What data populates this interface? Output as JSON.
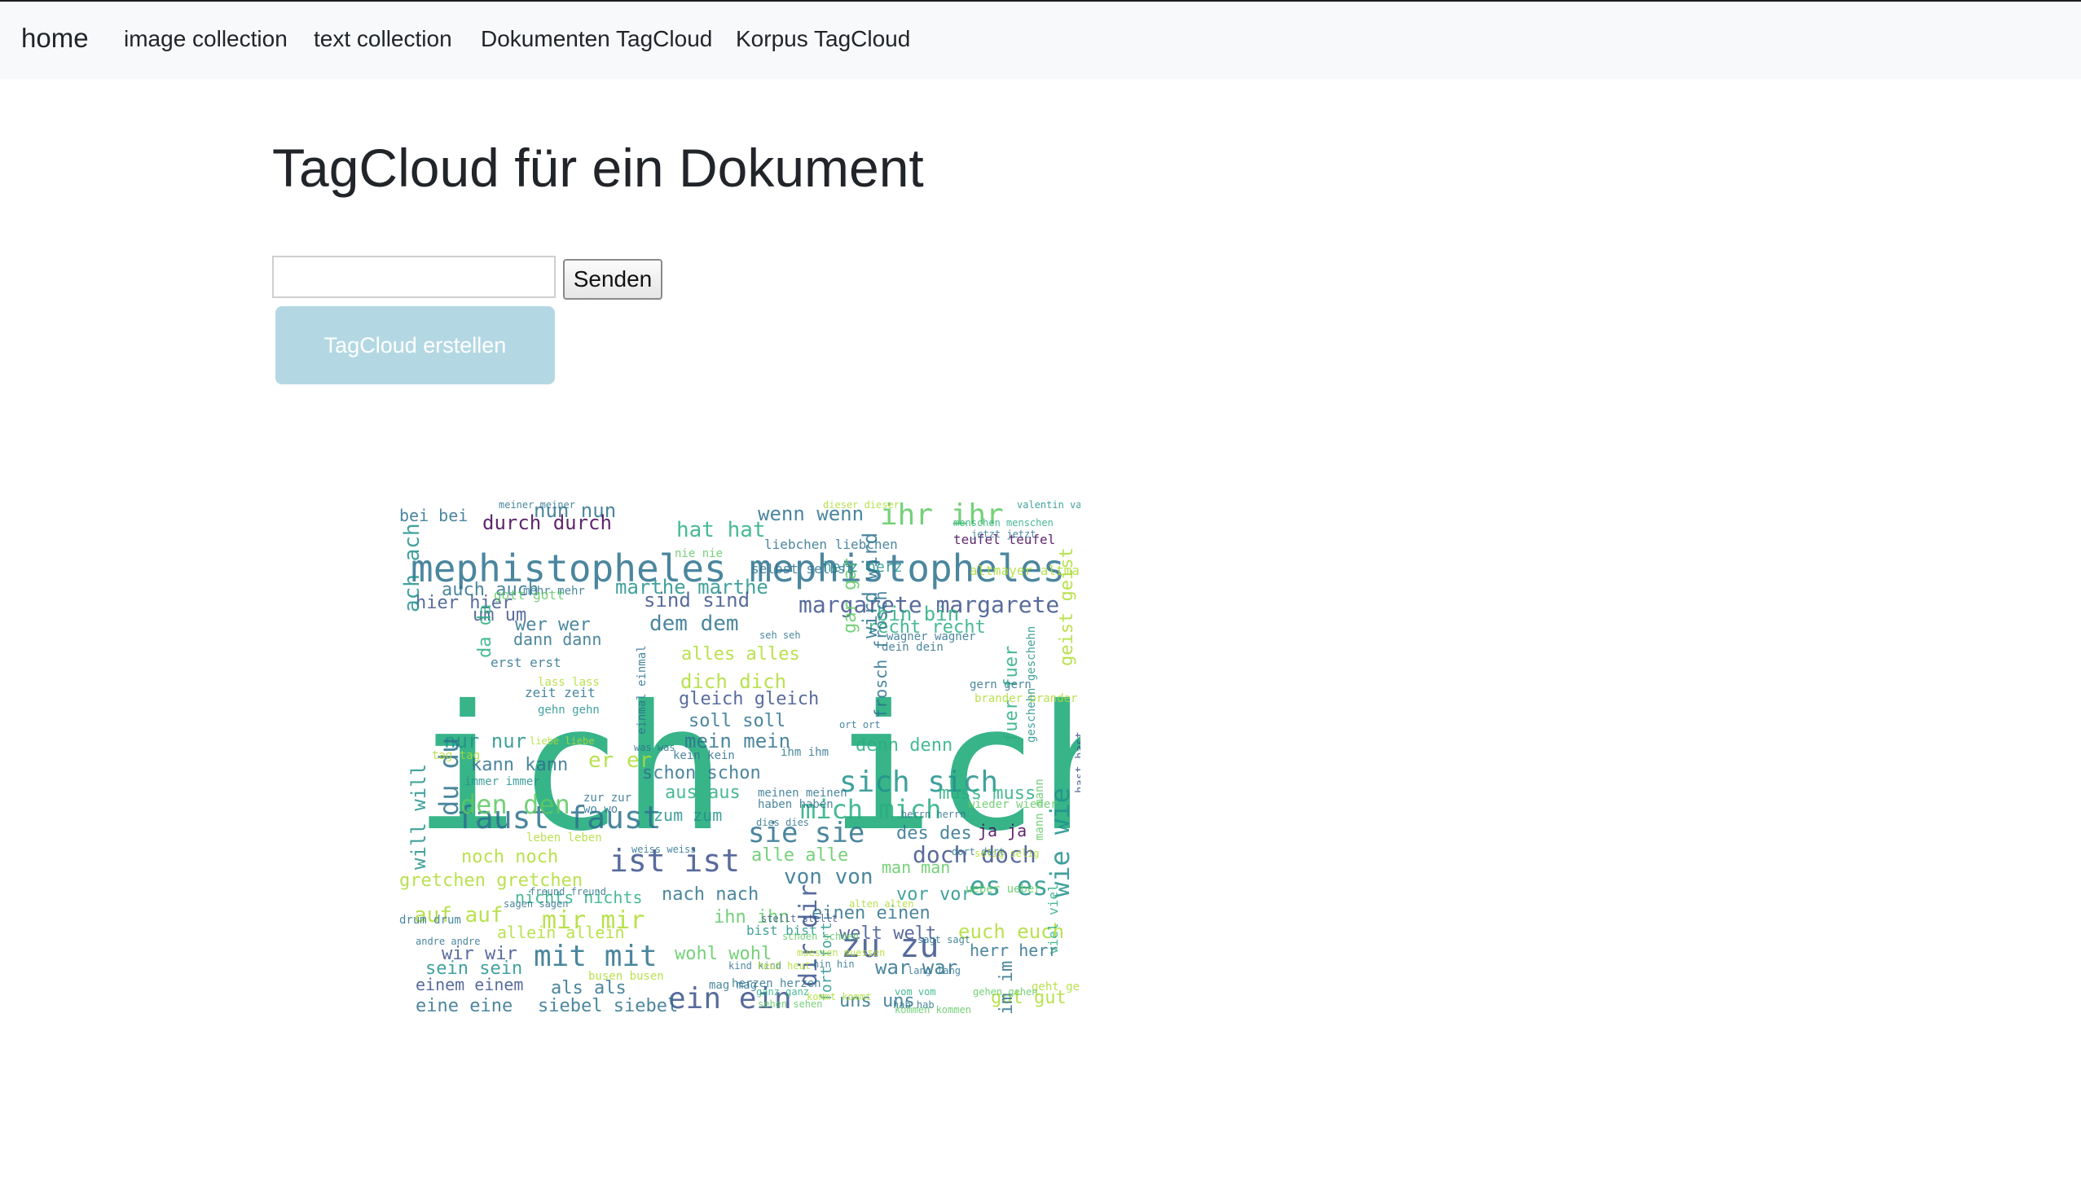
{
  "nav": {
    "brand": "home",
    "links": [
      "image collection",
      "text collection",
      "Dokumenten TagCloud",
      "Korpus TagCloud"
    ]
  },
  "page": {
    "title": "TagCloud für ein Dokument"
  },
  "form": {
    "input_value": "",
    "submit_label": "Senden"
  },
  "create_button": {
    "label": "TagCloud erstellen"
  },
  "colors": {
    "nav_bg": "#f8f9fa",
    "create_button_bg": "#b4d8e3",
    "cloud_palette": [
      "#3b528b",
      "#2c728e",
      "#21918c",
      "#28ae80",
      "#5ec962",
      "#addc30",
      "#440154"
    ]
  },
  "tagcloud": {
    "words": [
      {
        "t": "ich ich",
        "c": 3
      },
      {
        "t": "mephistopheles mephistopheles",
        "c": 1
      },
      {
        "t": "margarete margarete",
        "c": 0
      },
      {
        "t": "faust faust",
        "c": 1
      },
      {
        "t": "ist ist",
        "c": 0
      },
      {
        "t": "sich sich",
        "c": 2
      },
      {
        "t": "sie sie",
        "c": 1
      },
      {
        "t": "ein ein",
        "c": 0
      },
      {
        "t": "zu zu",
        "c": 0
      },
      {
        "t": "mit mit",
        "c": 1
      },
      {
        "t": "mir mir",
        "c": 5
      },
      {
        "t": "den den",
        "c": 4
      },
      {
        "t": "es es",
        "c": 2
      },
      {
        "t": "mich mich",
        "c": 3
      },
      {
        "t": "doch doch",
        "c": 0
      },
      {
        "t": "ihr ihr",
        "c": 4
      },
      {
        "t": "wenn wenn",
        "c": 1
      },
      {
        "t": "nun nun",
        "c": 1
      },
      {
        "t": "bei bei",
        "c": 1
      },
      {
        "t": "durch durch",
        "c": 6
      },
      {
        "t": "hat hat",
        "c": 3
      },
      {
        "t": "auch auch",
        "c": 1
      },
      {
        "t": "marthe marthe",
        "c": 2
      },
      {
        "t": "hier hier",
        "c": 0
      },
      {
        "t": "sind sind",
        "c": 0
      },
      {
        "t": "um um",
        "c": 0
      },
      {
        "t": "wer wer",
        "c": 1
      },
      {
        "t": "dem dem",
        "c": 1
      },
      {
        "t": "bin bin",
        "c": 3
      },
      {
        "t": "recht recht",
        "c": 3
      },
      {
        "t": "dann dann",
        "c": 1
      },
      {
        "t": "alles alles",
        "c": 5
      },
      {
        "t": "dich dich",
        "c": 5
      },
      {
        "t": "gleich gleich",
        "c": 0
      },
      {
        "t": "soll soll",
        "c": 1
      },
      {
        "t": "nur nur",
        "c": 2
      },
      {
        "t": "mein mein",
        "c": 1
      },
      {
        "t": "denn denn",
        "c": 3
      },
      {
        "t": "kann kann",
        "c": 1
      },
      {
        "t": "er er",
        "c": 5
      },
      {
        "t": "schon schon",
        "c": 1
      },
      {
        "t": "aus aus",
        "c": 3
      },
      {
        "t": "muss muss",
        "c": 3
      },
      {
        "t": "zum zum",
        "c": 2
      },
      {
        "t": "des des",
        "c": 1
      },
      {
        "t": "ja ja",
        "c": 6
      },
      {
        "t": "noch noch",
        "c": 5
      },
      {
        "t": "alle alle",
        "c": 4
      },
      {
        "t": "gretchen gretchen",
        "c": 5
      },
      {
        "t": "von von",
        "c": 1
      },
      {
        "t": "man man",
        "c": 4
      },
      {
        "t": "nichts nichts",
        "c": 3
      },
      {
        "t": "nach nach",
        "c": 1
      },
      {
        "t": "vor vor",
        "c": 2
      },
      {
        "t": "auf auf",
        "c": 5
      },
      {
        "t": "ihn ihn",
        "c": 4
      },
      {
        "t": "einen einen",
        "c": 1
      },
      {
        "t": "allein allein",
        "c": 5
      },
      {
        "t": "welt welt",
        "c": 0
      },
      {
        "t": "euch euch",
        "c": 5
      },
      {
        "t": "wir wir",
        "c": 0
      },
      {
        "t": "sein sein",
        "c": 2
      },
      {
        "t": "bist bist",
        "c": 2
      },
      {
        "t": "wohl wohl",
        "c": 4
      },
      {
        "t": "war war",
        "c": 1
      },
      {
        "t": "herr herr",
        "c": 1
      },
      {
        "t": "einem einem",
        "c": 0
      },
      {
        "t": "als als",
        "c": 1
      },
      {
        "t": "eine eine",
        "c": 1
      },
      {
        "t": "siebel siebel",
        "c": 1
      },
      {
        "t": "uns uns",
        "c": 1
      },
      {
        "t": "gut gut",
        "c": 5
      },
      {
        "t": "ach ach",
        "c": 2
      },
      {
        "t": "du du",
        "c": 1
      },
      {
        "t": "da da",
        "c": 3
      },
      {
        "t": "will will",
        "c": 2
      },
      {
        "t": "wird wird",
        "c": 1
      },
      {
        "t": "gar gar",
        "c": 4
      },
      {
        "t": "fuer fuer",
        "c": 3
      },
      {
        "t": "geist geist",
        "c": 5
      },
      {
        "t": "wie wie",
        "c": 2
      },
      {
        "t": "dir dir",
        "c": 0
      },
      {
        "t": "im im",
        "c": 1
      },
      {
        "t": "fort fort",
        "c": 2
      },
      {
        "t": "frosch frosch",
        "c": 1
      },
      {
        "t": "viel viel",
        "c": 3
      },
      {
        "t": "teufel teufel",
        "c": 6
      },
      {
        "t": "herz herz",
        "c": 2
      },
      {
        "t": "altmayer altmayer",
        "c": 5
      },
      {
        "t": "liebchen liebchen",
        "c": 1
      },
      {
        "t": "nie nie",
        "c": 4
      },
      {
        "t": "selbst selbst",
        "c": 1
      },
      {
        "t": "erst erst",
        "c": 1
      },
      {
        "t": "mehr mehr",
        "c": 1
      },
      {
        "t": "gott gott",
        "c": 4
      },
      {
        "t": "wagner wagner",
        "c": 1
      },
      {
        "t": "dein dein",
        "c": 1
      },
      {
        "t": "lass lass",
        "c": 5
      },
      {
        "t": "zeit zeit",
        "c": 1
      },
      {
        "t": "gehn gehn",
        "c": 2
      },
      {
        "t": "gern gern",
        "c": 1
      },
      {
        "t": "brander brander",
        "c": 5
      },
      {
        "t": "immer immer",
        "c": 2
      },
      {
        "t": "zur zur",
        "c": 1
      },
      {
        "t": "wo wo",
        "c": 1
      },
      {
        "t": "meinen meinen",
        "c": 1
      },
      {
        "t": "haben haben",
        "c": 1
      },
      {
        "t": "wieder wieder",
        "c": 4
      },
      {
        "t": "leben leben",
        "c": 5
      },
      {
        "t": "ueber ueber",
        "c": 4
      },
      {
        "t": "busen busen",
        "c": 5
      },
      {
        "t": "herzen herzen",
        "c": 1
      },
      {
        "t": "mag mag",
        "c": 1
      },
      {
        "t": "geht geht",
        "c": 5
      },
      {
        "t": "kein kein",
        "c": 1
      },
      {
        "t": "ihm ihm",
        "c": 1
      },
      {
        "t": "tag tag",
        "c": 5
      },
      {
        "t": "drum drum",
        "c": 1
      },
      {
        "t": "stellt stellt",
        "c": 0
      },
      {
        "t": "nacht nacht",
        "c": 1
      },
      {
        "t": "kommt kommt",
        "c": 5
      },
      {
        "t": "valentin valentin",
        "c": 2
      },
      {
        "t": "menschen menschen",
        "c": 3
      },
      {
        "t": "geschehn geschehn",
        "c": 2
      },
      {
        "t": "mann mann",
        "c": 4
      },
      {
        "t": "hast hast",
        "c": 0
      },
      {
        "t": "einmal einmal",
        "c": 1
      },
      {
        "t": "was was",
        "c": 1
      },
      {
        "t": "liebe liebe",
        "c": 5
      },
      {
        "t": "freund freund",
        "c": 1
      },
      {
        "t": "sagen sagen",
        "c": 1
      },
      {
        "t": "kind kind",
        "c": 1
      },
      {
        "t": "lang lang",
        "c": 1
      },
      {
        "t": "dort dort",
        "c": 1
      },
      {
        "t": "herrn herrn",
        "c": 1
      },
      {
        "t": "dies dies",
        "c": 1
      },
      {
        "t": "hin hin",
        "c": 1
      },
      {
        "t": "hab hab",
        "c": 1
      },
      {
        "t": "ganz ganz",
        "c": 3
      },
      {
        "t": "vom vom",
        "c": 3
      },
      {
        "t": "gehen gehen",
        "c": 4
      },
      {
        "t": "kommen kommen",
        "c": 4
      },
      {
        "t": "sehen sehen",
        "c": 4
      },
      {
        "t": "alten alten",
        "c": 5
      },
      {
        "t": "schoen schoen",
        "c": 4
      },
      {
        "t": "heut heut",
        "c": 5
      },
      {
        "t": "selig selig",
        "c": 5
      },
      {
        "t": "muessen muessen",
        "c": 5
      },
      {
        "t": "sagt sagt",
        "c": 1
      },
      {
        "t": "andre andre",
        "c": 1
      },
      {
        "t": "meiner meiner",
        "c": 1
      },
      {
        "t": "dieser dieser",
        "c": 5
      },
      {
        "t": "jetzt jetzt",
        "c": 1
      },
      {
        "t": "ort ort",
        "c": 1
      },
      {
        "t": "seh seh",
        "c": 1
      },
      {
        "t": "weiss weiss",
        "c": 1
      }
    ]
  }
}
